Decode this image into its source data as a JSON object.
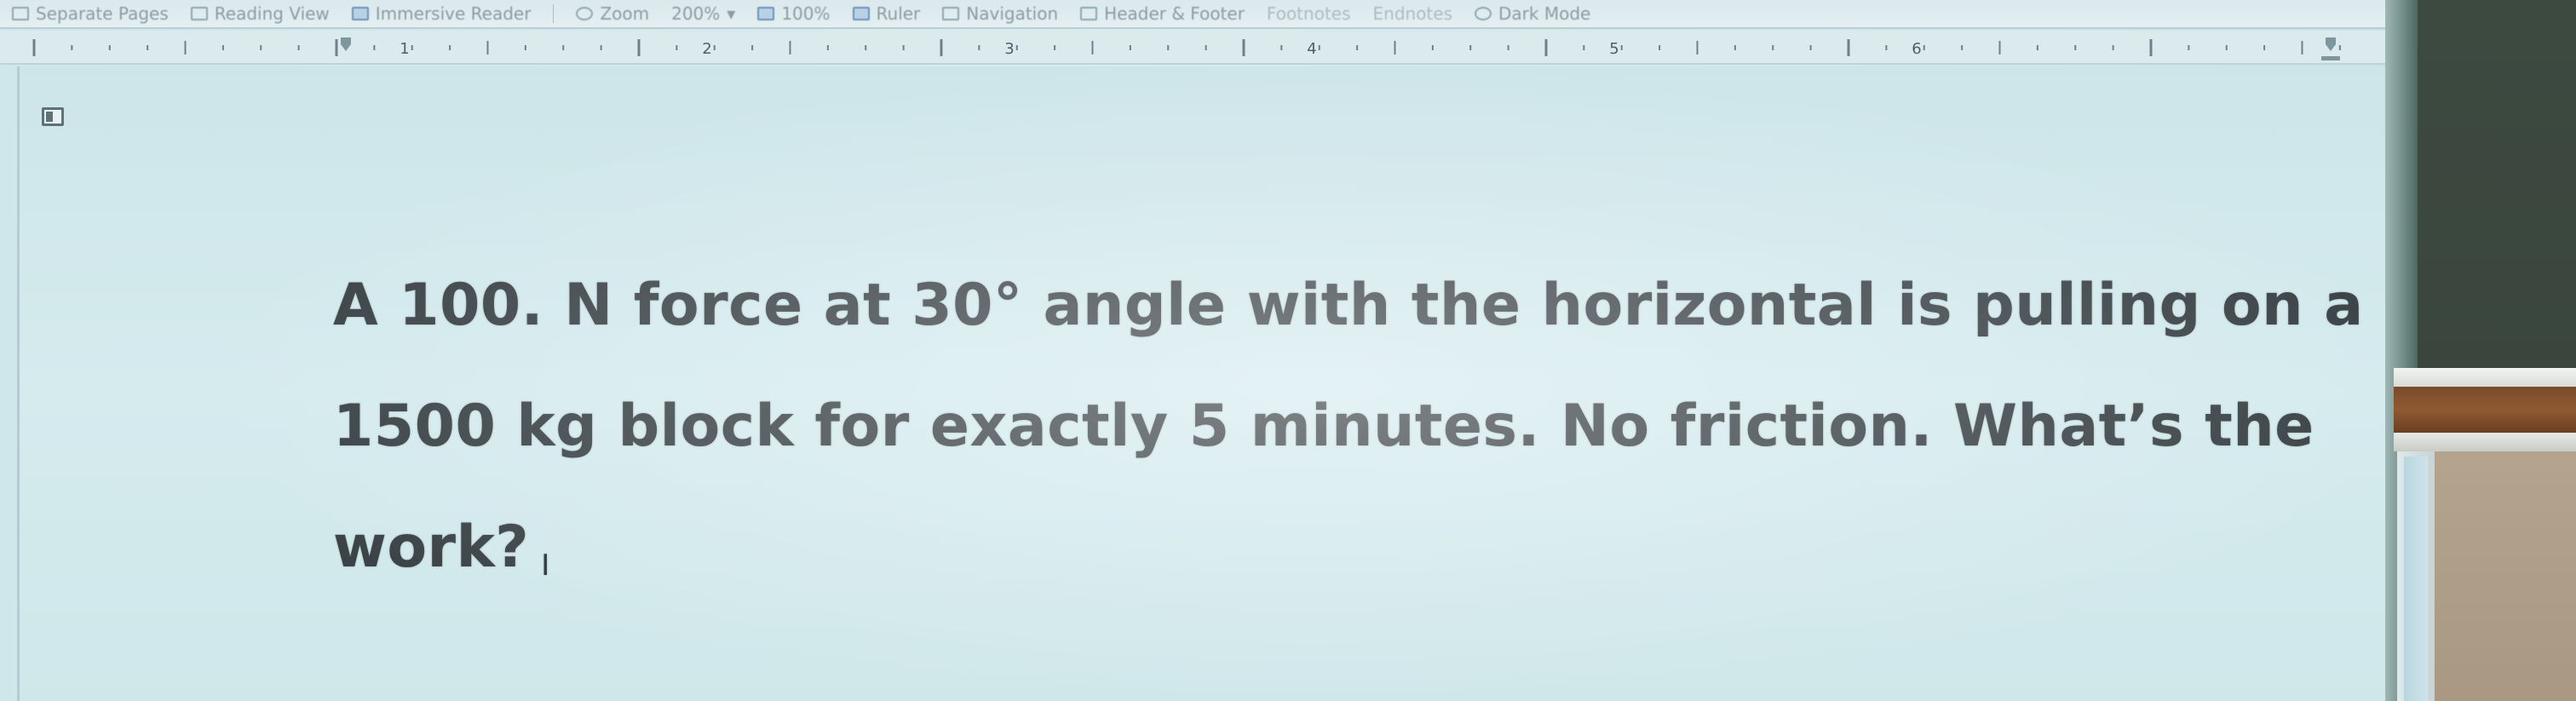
{
  "ribbon": {
    "items": [
      {
        "icon": "pages-icon",
        "label": "Separate Pages"
      },
      {
        "icon": "book-icon",
        "label": "Reading View"
      },
      {
        "icon": "reader-icon",
        "label": "Immersive Reader"
      },
      {
        "icon": "search-icon",
        "label": "Zoom"
      },
      {
        "icon": "",
        "label": "200%"
      },
      {
        "icon": "zoom-100-icon",
        "label": "100%"
      },
      {
        "icon": "ruler-icon",
        "label": "Ruler"
      },
      {
        "icon": "navigation-icon",
        "label": "Navigation"
      },
      {
        "icon": "header-icon",
        "label": "Header & Footer"
      },
      {
        "icon": "",
        "label": "Footnotes"
      },
      {
        "icon": "",
        "label": "Endnotes"
      },
      {
        "icon": "moon-icon",
        "label": "Dark Mode"
      }
    ]
  },
  "ruler": {
    "numbers": [
      "1",
      "2",
      "3",
      "4",
      "5",
      "6"
    ]
  },
  "document": {
    "lines": [
      "A 100. N force at 30° angle with the horizontal is pulling on a",
      "1500 kg block for exactly 5 minutes. No friction. What’s the",
      "work?"
    ],
    "cursor": "I"
  },
  "colors": {
    "screen": "#d2e9ec",
    "text": "#3b4347",
    "wall": "#3d4a40",
    "wood": "#8f5a33"
  }
}
